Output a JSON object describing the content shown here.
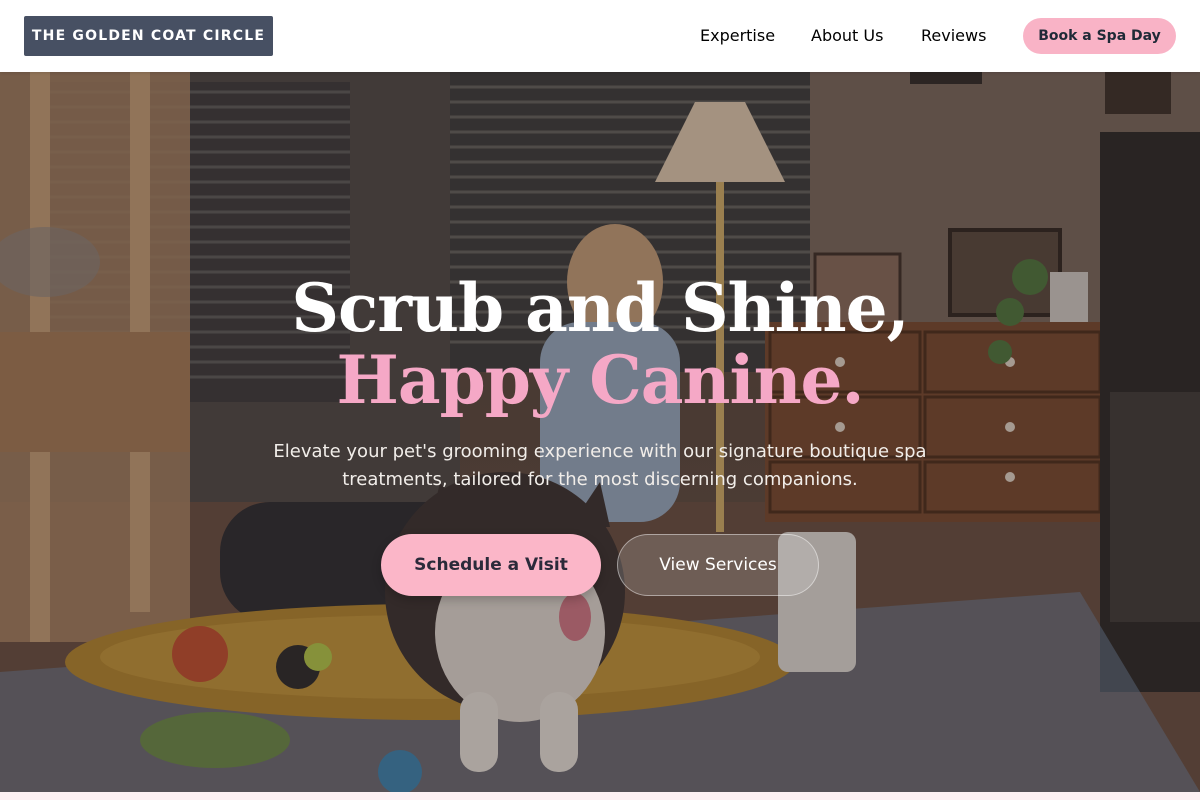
{
  "brand": {
    "logo_text": "THE GOLDEN COAT CIRCLE"
  },
  "nav": {
    "links": [
      {
        "label": "Expertise"
      },
      {
        "label": "About Us"
      },
      {
        "label": "Reviews"
      }
    ],
    "cta_label": "Book a Spa Day"
  },
  "hero": {
    "title_line1": "Scrub and Shine,",
    "title_line2": "Happy Canine.",
    "subtitle": "Elevate your pet's grooming experience with our signature boutique spa treatments, tailored for the most discerning companions.",
    "primary_button": "Schedule a Visit",
    "secondary_button": "View Services"
  },
  "colors": {
    "logo_bg": "#475063",
    "accent_pink": "#f9b3c6",
    "title_pink": "#f5a8c6",
    "nav_text": "#374151"
  }
}
